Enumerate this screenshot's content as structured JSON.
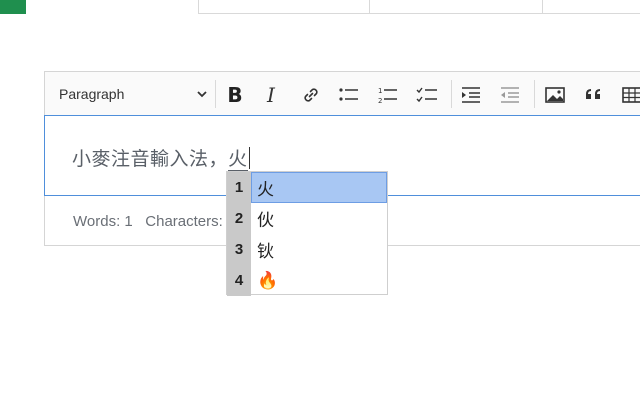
{
  "toolbar": {
    "block_format": "Paragraph",
    "bold_glyph": "B",
    "italic_glyph": "I",
    "icons": [
      "chevron-down-icon",
      "bold-icon",
      "italic-icon",
      "link-icon",
      "bulleted-list-icon",
      "numbered-list-icon",
      "todo-list-icon",
      "indent-icon",
      "outdent-icon",
      "image-icon",
      "blockquote-icon",
      "table-icon"
    ]
  },
  "editor": {
    "committed_text": "小麥注音輸入法，",
    "composing_text": "火"
  },
  "status": {
    "words": "Words: 1",
    "characters": "Characters: 8"
  },
  "ime": {
    "candidates": [
      {
        "num": "1",
        "char": "火",
        "selected": true
      },
      {
        "num": "2",
        "char": "伙",
        "selected": false
      },
      {
        "num": "3",
        "char": "钬",
        "selected": false
      },
      {
        "num": "4",
        "char": "🔥",
        "selected": false
      }
    ]
  },
  "colors": {
    "accent_border": "#4f8fdb",
    "selected_candidate": "#a8c7f3",
    "sheet_tab": "#1f8f4e"
  }
}
